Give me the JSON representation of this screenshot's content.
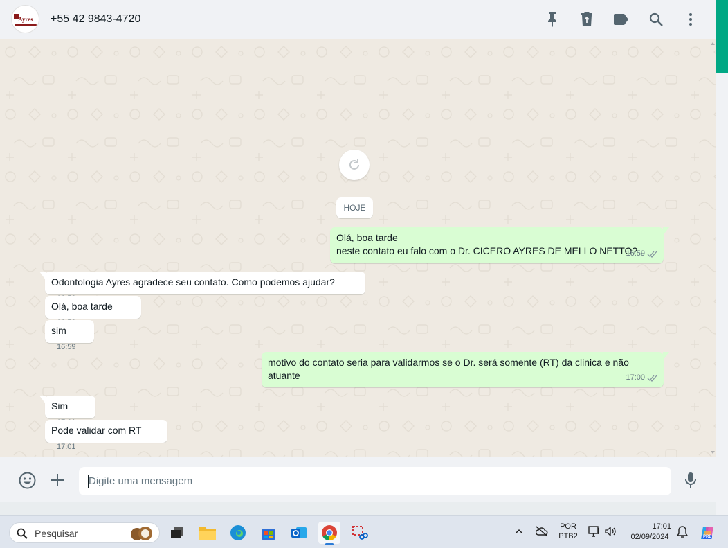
{
  "header": {
    "avatar_logo_text": "Ayres",
    "contact_name": "+55 42 9843-4720",
    "icons": [
      "pin-icon",
      "delete-icon",
      "label-icon",
      "search-icon",
      "menu-icon"
    ]
  },
  "chat": {
    "date_chip": "HOJE",
    "messages": [
      {
        "direction": "out",
        "text": "Olá, boa tarde\nneste contato eu falo com o Dr. CICERO AYRES DE MELLO NETTO?",
        "time": "16:59"
      },
      {
        "direction": "in",
        "text": "Odontologia Ayres agradece seu contato. Como podemos ajudar?",
        "time": "16:59"
      },
      {
        "direction": "in",
        "text": "Olá, boa tarde",
        "time": "16:59"
      },
      {
        "direction": "in",
        "text": "sim",
        "time": "16:59"
      },
      {
        "direction": "out",
        "text": "motivo do contato seria para validarmos se o Dr. será somente (RT) da clinica e não\natuante",
        "time": "17:00"
      },
      {
        "direction": "in",
        "text": "Sim",
        "time": "17:01"
      },
      {
        "direction": "in",
        "text": "Pode validar com RT",
        "time": "17:01"
      }
    ]
  },
  "composer": {
    "placeholder": "Digite uma mensagem"
  },
  "taskbar": {
    "search_label": "Pesquisar",
    "lang_line1": "POR",
    "lang_line2": "PTB2",
    "time": "17:01",
    "date": "02/09/2024",
    "copilot_badge": "PRE"
  },
  "colors": {
    "outgoing_bubble": "#d9fdd3",
    "incoming_bubble": "#ffffff",
    "chat_background": "#efeae2",
    "accent": "#00a884"
  }
}
